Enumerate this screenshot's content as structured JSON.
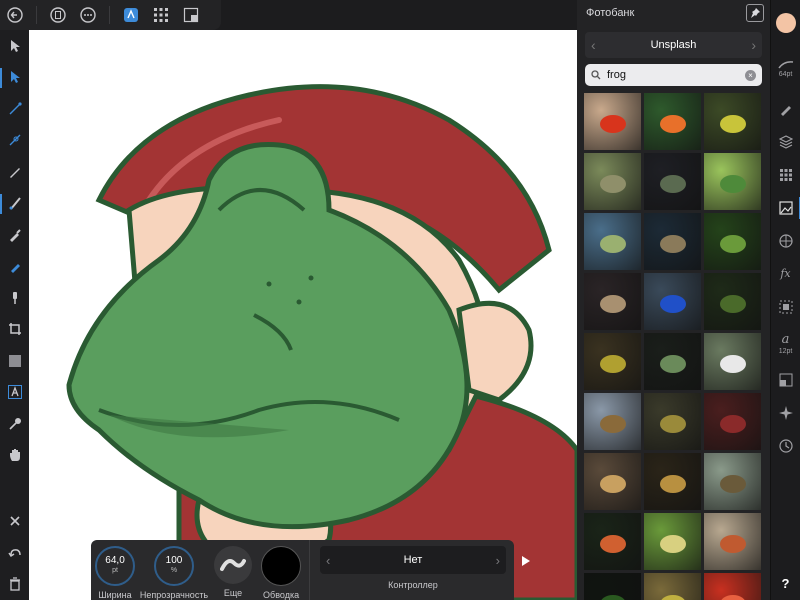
{
  "colors": {
    "accent": "#3d8bd9",
    "frog_green": "#5a9e5e",
    "frog_outline": "#2a5a32",
    "cap_red": "#a33434",
    "skin": "#f7d4bd",
    "primary_color": "#f3c4a5"
  },
  "topbar": {
    "icons": [
      "back-icon",
      "document-icon",
      "more-icon",
      "persona-icon",
      "grid-icon",
      "export-persona-icon"
    ]
  },
  "left_tools": [
    "move-tool-icon",
    "node-tool-icon",
    "corner-tool-icon",
    "contour-tool-icon",
    "pencil-tool-icon",
    "vector-brush-icon",
    "pen-tool-icon",
    "fill-tool-icon",
    "transparency-tool-icon",
    "crop-tool-icon",
    "shape-tool-icon",
    "text-tool-icon",
    "color-picker-icon",
    "hand-tool-icon"
  ],
  "left_bottom": [
    "close-icon",
    "undo-icon",
    "delete-icon"
  ],
  "context": {
    "width_value": "64,0",
    "width_unit": "pt",
    "width_label": "Ширина",
    "opacity_value": "100",
    "opacity_unit": "%",
    "opacity_label": "Непрозрачность",
    "more_label": "Еще",
    "stroke_label": "Обводка",
    "controller_value": "Нет",
    "controller_label": "Контроллер"
  },
  "stock": {
    "title": "Фотобанк",
    "source": "Unsplash",
    "search_query": "frog",
    "results": [
      {
        "bg": "#c9a98c",
        "fg": "#d8341c"
      },
      {
        "bg": "#2e5a2c",
        "fg": "#e8702a"
      },
      {
        "bg": "#3c4a26",
        "fg": "#c8c43a"
      },
      {
        "bg": "#7b8a5a",
        "fg": "#8f8f6a"
      },
      {
        "bg": "#1e1f24",
        "fg": "#5a6a50"
      },
      {
        "bg": "#9ac45c",
        "fg": "#4e8a3a"
      },
      {
        "bg": "#4a6e8a",
        "fg": "#9ab070"
      },
      {
        "bg": "#1c2a36",
        "fg": "#8a7a5a"
      },
      {
        "bg": "#24431a",
        "fg": "#6a9a3a"
      },
      {
        "bg": "#2a2426",
        "fg": "#a89070"
      },
      {
        "bg": "#3a4a5a",
        "fg": "#2050c8"
      },
      {
        "bg": "#1e2a18",
        "fg": "#4a6a2a"
      },
      {
        "bg": "#3a3220",
        "fg": "#b0a030"
      },
      {
        "bg": "#1a1e1a",
        "fg": "#6a8a5a"
      },
      {
        "bg": "#6a7a60",
        "fg": "#e8e8e8"
      },
      {
        "bg": "#8a98a8",
        "fg": "#8a6a3a"
      },
      {
        "bg": "#3a3a2a",
        "fg": "#9a8a3a"
      },
      {
        "bg": "#4a1e1e",
        "fg": "#8a2a2a"
      },
      {
        "bg": "#5a4a3a",
        "fg": "#c8a060"
      },
      {
        "bg": "#2a2418",
        "fg": "#b89040"
      },
      {
        "bg": "#8a9a8a",
        "fg": "#6a5a3a"
      },
      {
        "bg": "#1a2418",
        "fg": "#d06030"
      },
      {
        "bg": "#6a9a3a",
        "fg": "#d8d080"
      },
      {
        "bg": "#b8a890",
        "fg": "#c05a30"
      },
      {
        "bg": "#101410",
        "fg": "#2a5a20"
      },
      {
        "bg": "#7a6a3a",
        "fg": "#c0b040"
      },
      {
        "bg": "#c83020",
        "fg": "#e86040"
      }
    ]
  },
  "studio": {
    "brush_size": "64pt",
    "text_size": "12pt",
    "icons": [
      "color-icon",
      "brush-stroke-icon",
      "brushes-icon",
      "layers-icon",
      "swatches-icon",
      "stock-icon",
      "appearance-icon",
      "effects-icon",
      "transform-icon",
      "text-styles-icon",
      "navigator-icon",
      "constraints-icon",
      "history-icon",
      "help-icon"
    ],
    "help": "?"
  }
}
